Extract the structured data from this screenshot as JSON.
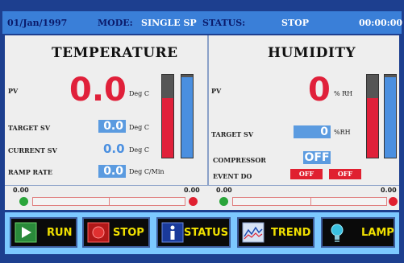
{
  "topbar": {
    "date": "01/Jan/1997",
    "mode_label": "MODE:",
    "mode_value": "SINGLE SP",
    "status_label": "STATUS:",
    "status_value": "STOP",
    "time": "00:00:00"
  },
  "temperature": {
    "title": "TEMPERATURE",
    "pv_label": "PV",
    "pv_value": "0.0",
    "pv_unit": "Deg C",
    "target_label": "TARGET SV",
    "target_value": "0.0",
    "target_unit": "Deg C",
    "current_label": "CURRENT SV",
    "current_value": "0.0",
    "current_unit": "Deg C",
    "ramp_label": "RAMP RATE",
    "ramp_value": "0.0",
    "ramp_unit": "Deg C/Min",
    "bar_pv_level": 0.72,
    "bar_sv_level": 0.97,
    "scale_min": "0.00",
    "scale_max": "0.00"
  },
  "humidity": {
    "title": "HUMIDITY",
    "pv_label": "PV",
    "pv_value": "0",
    "pv_unit": "% RH",
    "target_label": "TARGET SV",
    "target_value": "0",
    "target_unit": "%RH",
    "compressor_label": "COMPRESSOR",
    "compressor_value": "OFF",
    "event_label": "EVENT DO",
    "event_1": "OFF",
    "event_2": "OFF",
    "bar_pv_level": 0.72,
    "bar_sv_level": 0.97,
    "scale_min": "0.00",
    "scale_max": "0.00"
  },
  "buttons": {
    "run": "RUN",
    "stop": "STOP",
    "status": "STATUS",
    "trend": "TREND",
    "lamp": "LAMP"
  },
  "colors": {
    "pv_red": "#e0203a",
    "sv_blue": "#4a8fe0",
    "button_text": "#f0e000",
    "start_green": "#2aa53a",
    "end_red": "#e02030"
  }
}
